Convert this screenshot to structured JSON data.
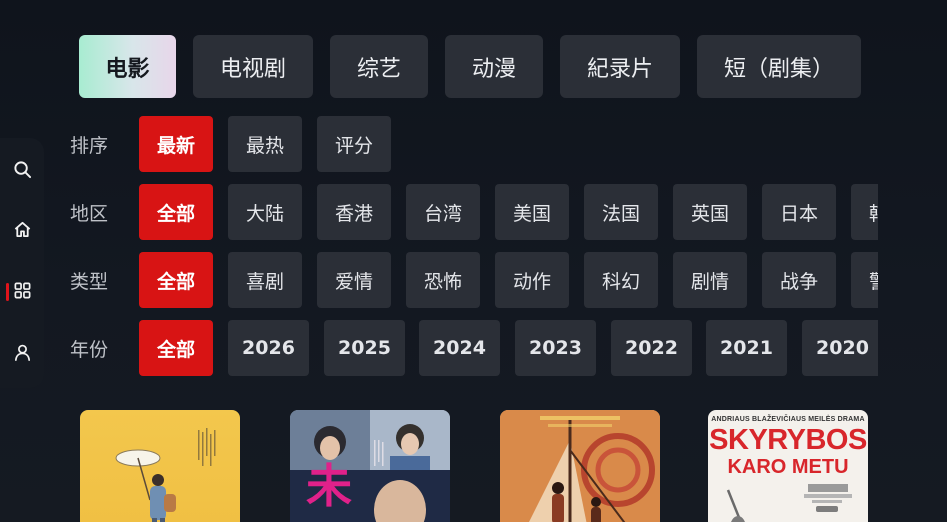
{
  "nav": {
    "tabs": [
      "电影",
      "电视剧",
      "综艺",
      "动漫",
      "紀录片",
      "短（剧集）"
    ],
    "active_tab": 0
  },
  "sidebar": {
    "items": [
      {
        "icon": "search-icon"
      },
      {
        "icon": "home-icon"
      },
      {
        "icon": "grid-icon",
        "active": true
      },
      {
        "icon": "user-icon"
      }
    ]
  },
  "filters": {
    "sort": {
      "label": "排序",
      "options": [
        "最新",
        "最热",
        "评分"
      ],
      "active": 0
    },
    "region": {
      "label": "地区",
      "options": [
        "全部",
        "大陆",
        "香港",
        "台湾",
        "美国",
        "法国",
        "英国",
        "日本",
        "韩国"
      ],
      "active": 0
    },
    "genre": {
      "label": "类型",
      "options": [
        "全部",
        "喜剧",
        "爱情",
        "恐怖",
        "动作",
        "科幻",
        "剧情",
        "战争",
        "警匪"
      ],
      "active": 0
    },
    "year": {
      "label": "年份",
      "options": [
        "全部",
        "2026",
        "2025",
        "2024",
        "2023",
        "2022",
        "2021",
        "2020"
      ],
      "active": 0
    }
  },
  "posters": [
    {
      "title": ""
    },
    {
      "title": "未"
    },
    {
      "title": ""
    },
    {
      "title": "SKYRYBOS",
      "subtitle": "KARO METU",
      "tagline": "ANDRIAUS BLAŽEVIČIAUS MEILĖS DRAMA"
    }
  ],
  "colors": {
    "accent": "#d81414",
    "chip_bg": "#2b2f37"
  }
}
